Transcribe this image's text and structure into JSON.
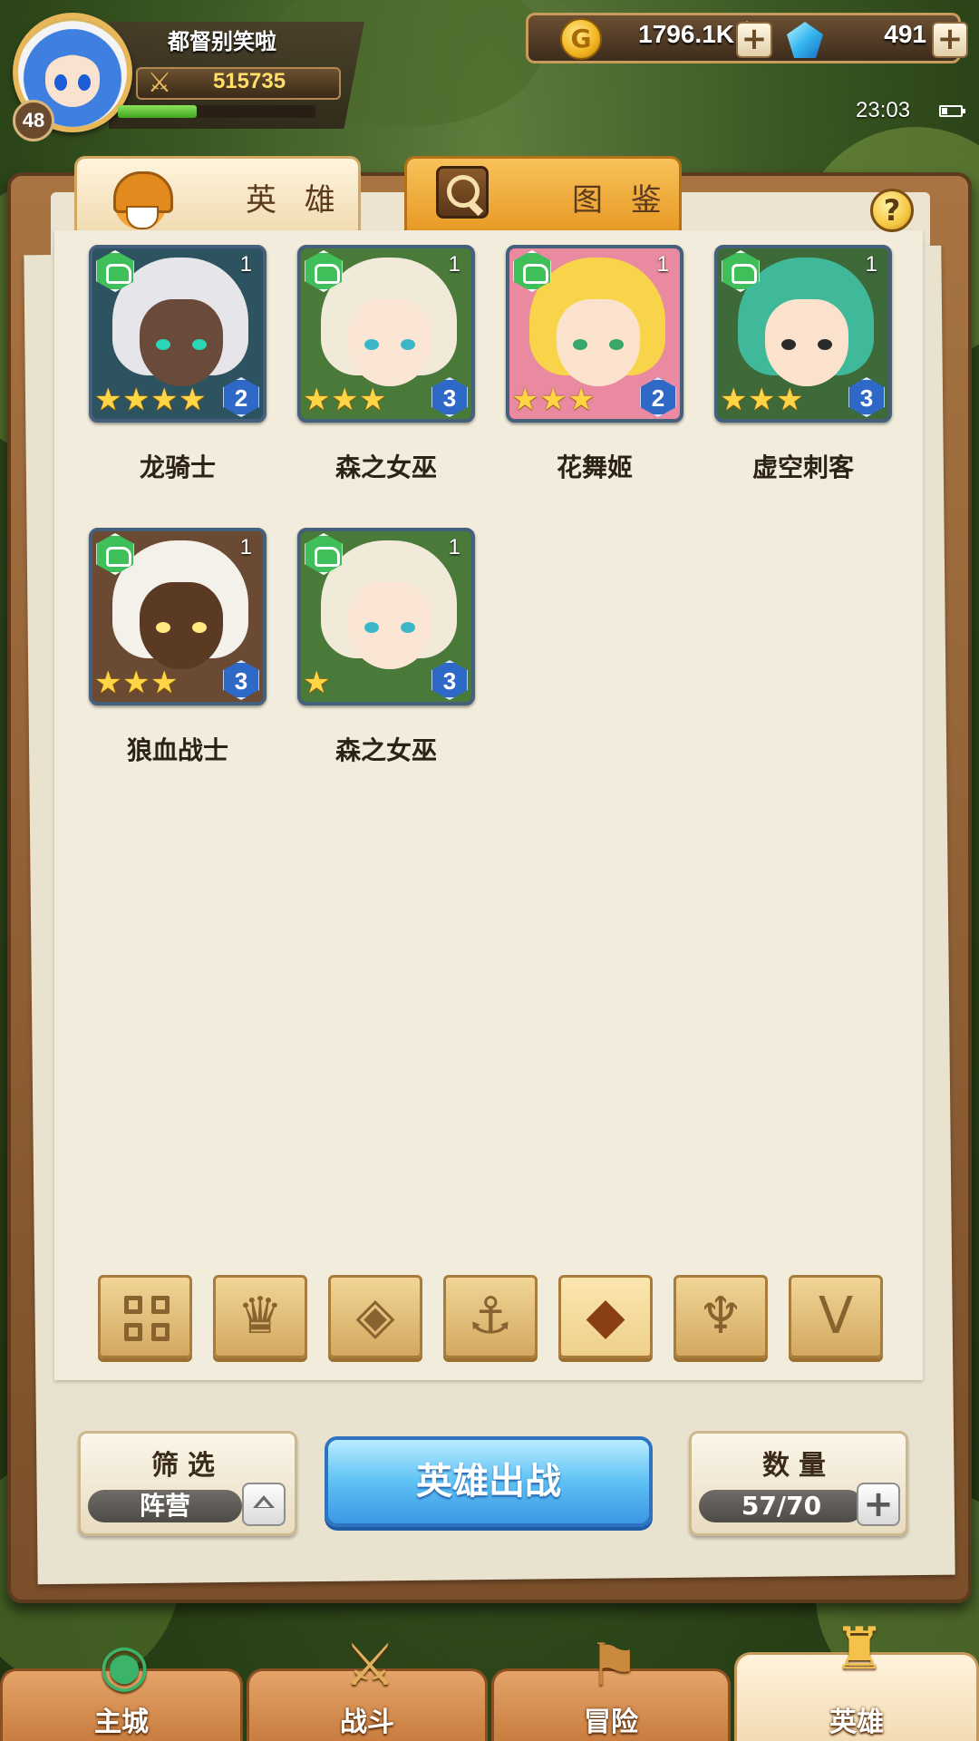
{
  "player": {
    "name": "都督别笑啦",
    "level": "48",
    "power": "515735",
    "exp_progress": 0.4
  },
  "currency": {
    "gold": "1796.1K",
    "gems": "491"
  },
  "status": {
    "time": "23:03",
    "battery_level": 0.3
  },
  "tabs": {
    "heroes": "英 雄",
    "codex": "图 鉴",
    "active": "heroes"
  },
  "heroes": [
    {
      "name": "龙骑士",
      "count": "1",
      "stars": 4,
      "grade": "2",
      "hair": "#e6e6ea",
      "face": "#6a4a3a",
      "eye": "#2ad6b6",
      "bg": "#2e5360"
    },
    {
      "name": "森之女巫",
      "count": "1",
      "stars": 3,
      "grade": "3",
      "hair": "#f2ead8",
      "face": "#fbe6d6",
      "eye": "#3ab6c6",
      "bg": "#4a7a3a"
    },
    {
      "name": "花舞姬",
      "count": "1",
      "stars": 3,
      "grade": "2",
      "hair": "#f8d44a",
      "face": "#fbe2cc",
      "eye": "#37a86a",
      "bg": "#e98aa0"
    },
    {
      "name": "虚空刺客",
      "count": "1",
      "stars": 3,
      "grade": "3",
      "hair": "#3fb99a",
      "face": "#fbe2cc",
      "eye": "#2a2a2a",
      "bg": "#3e6a3a"
    },
    {
      "name": "狼血战士",
      "count": "1",
      "stars": 3,
      "grade": "3",
      "hair": "#f4f0ea",
      "face": "#5a3a22",
      "eye": "#ffe880",
      "bg": "#6a4a32"
    },
    {
      "name": "森之女巫",
      "count": "1",
      "stars": 1,
      "grade": "3",
      "hair": "#f2ead8",
      "face": "#fbe6d6",
      "eye": "#3ab6c6",
      "bg": "#4a7a3a"
    }
  ],
  "faction_filters": [
    {
      "icon": "all-grid-icon",
      "glyph": ""
    },
    {
      "icon": "flame-faction-icon",
      "glyph": "♛"
    },
    {
      "icon": "diamond-faction-icon",
      "glyph": "◈"
    },
    {
      "icon": "anchor-faction-icon",
      "glyph": "⚓"
    },
    {
      "icon": "beast-faction-icon",
      "glyph": "◆"
    },
    {
      "icon": "horned-faction-icon",
      "glyph": "♆"
    },
    {
      "icon": "wing-faction-icon",
      "glyph": "V"
    }
  ],
  "active_filter": 4,
  "controls": {
    "filter_title": "筛选",
    "filter_value": "阵营",
    "deploy_label": "英雄出战",
    "quantity_title": "数量",
    "quantity_value": "57/70"
  },
  "nav": [
    {
      "label": "主城",
      "icon": "castle-icon"
    },
    {
      "label": "战斗",
      "icon": "crossed-swords-icon"
    },
    {
      "label": "冒险",
      "icon": "map-scroll-icon"
    },
    {
      "label": "英雄",
      "icon": "hero-crest-icon"
    }
  ],
  "colors": {
    "accent_blue": "#5ec1f4",
    "wood": "#a87442",
    "paper": "#f2ecdc"
  }
}
